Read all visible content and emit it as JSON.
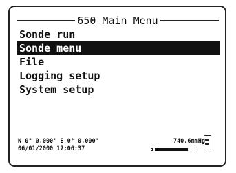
{
  "header": {
    "title": "650 Main Menu"
  },
  "menu": {
    "items": [
      {
        "label": "Sonde run",
        "selected": false
      },
      {
        "label": "Sonde menu",
        "selected": true
      },
      {
        "label": "File",
        "selected": false
      },
      {
        "label": "Logging setup",
        "selected": false
      },
      {
        "label": "System setup",
        "selected": false
      }
    ]
  },
  "status": {
    "coordinates": "N 0° 0.000' E 0° 0.000'",
    "pressure": "740.6mmHg",
    "datetime": "06/01/2000 17:06:37",
    "battery_level": 0.85
  },
  "icons": {
    "battery": "battery-icon",
    "memory": "memory-card-icon"
  }
}
